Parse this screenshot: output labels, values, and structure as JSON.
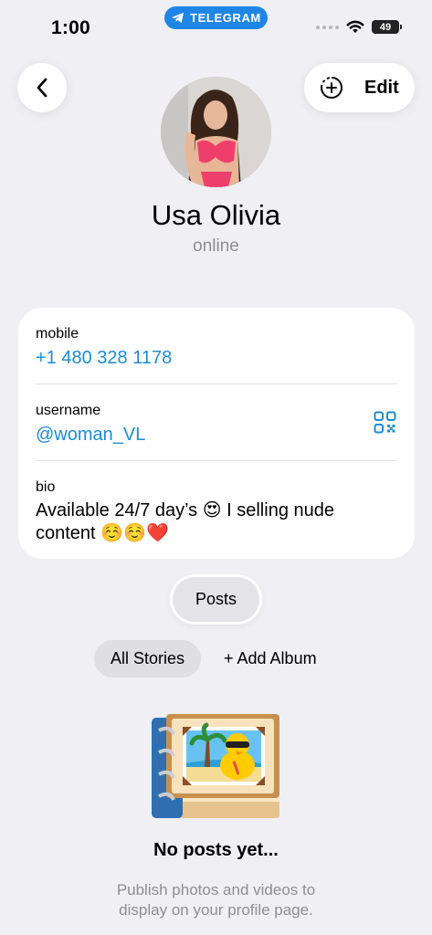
{
  "status_bar": {
    "time": "1:00",
    "app_pill": "TELEGRAM",
    "battery": "49"
  },
  "header": {
    "edit_label": "Edit"
  },
  "profile": {
    "name": "Usa Olivia",
    "presence": "online"
  },
  "info": {
    "mobile_label": "mobile",
    "mobile_value": "+1 480 328 1178",
    "username_label": "username",
    "username_value": "@woman_VL",
    "bio_label": "bio",
    "bio_line1": "Available 24/7 day’s 😍 I selling nude",
    "bio_line2": "content ☺️☺️❤️"
  },
  "tabs": {
    "posts": "Posts"
  },
  "stories": {
    "all": "All Stories",
    "add_album": "+ Add Album"
  },
  "empty_state": {
    "title": "No posts yet...",
    "line1": "Publish photos and videos to",
    "line2": "display on your profile page."
  },
  "colors": {
    "accent": "#1e8bd2",
    "pill": "#1f86e5",
    "background": "#efeff4"
  }
}
